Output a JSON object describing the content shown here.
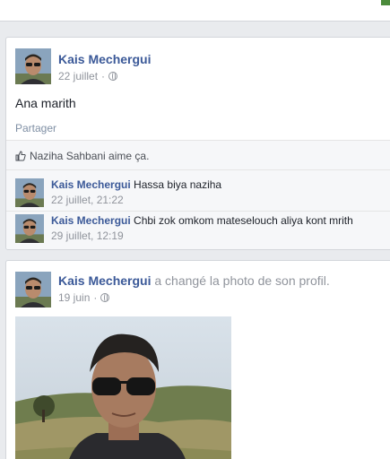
{
  "post1": {
    "author": "Kais Mechergui",
    "date": "22 juillet",
    "text": "Ana marith",
    "share_label": "Partager",
    "likes": "Naziha Sahbani aime ça.",
    "comments": [
      {
        "author": "Kais Mechergui",
        "text": "Hassa biya naziha",
        "date": "22 juillet, 21:22"
      },
      {
        "author": "Kais Mechergui",
        "text": "Chbi zok omkom mateselouch aliya kont mrith",
        "date": "29 juillet, 12:19"
      }
    ]
  },
  "post2": {
    "author": "Kais Mechergui",
    "action": "a changé la photo de son profil.",
    "date": "19 juin"
  },
  "colors": {
    "link_blue": "#3b5998",
    "meta_gray": "#90949c",
    "background": "#e9ebee"
  },
  "icons": [
    "globe-icon",
    "like-thumb-icon"
  ]
}
